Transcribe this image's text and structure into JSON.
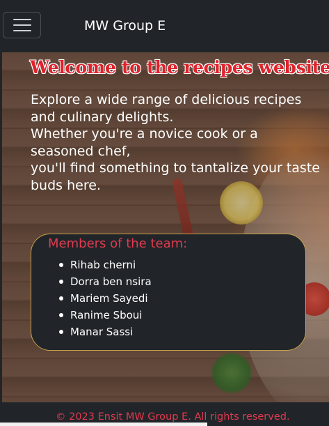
{
  "navbar": {
    "toggle_icon": "hamburger-menu-icon",
    "brand": "MW Group E"
  },
  "hero": {
    "title": "Welcome to the recipes website",
    "intro_lines": [
      "Explore a wide range of delicious recipes and culinary delights.",
      "Whether you're a novice cook or a seasoned chef,",
      "you'll find something to tantalize your taste buds here."
    ]
  },
  "team": {
    "title": "Members of the team:",
    "members": [
      "Rihab cherni",
      "Dorra ben nsira",
      "Mariem Sayedi",
      "Ranime Sboui",
      "Manar Sassi"
    ]
  },
  "footer": {
    "text": "© 2023 Ensit MW Group E. All rights reserved."
  },
  "colors": {
    "background": "#212529",
    "accent_red": "#e0222c",
    "footer_red": "#e03a4e",
    "card_border": "#c8a24a"
  }
}
